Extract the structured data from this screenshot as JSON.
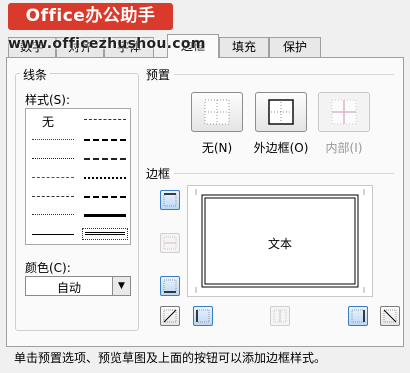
{
  "watermark": {
    "logo_text": "Office办公助手",
    "url_text": "www.officezhushou.com"
  },
  "tabs": [
    {
      "label": "数字",
      "active": false
    },
    {
      "label": "对齐",
      "active": false
    },
    {
      "label": "字体",
      "active": false
    },
    {
      "label": "边框",
      "active": true
    },
    {
      "label": "填充",
      "active": false
    },
    {
      "label": "保护",
      "active": false
    }
  ],
  "line": {
    "group_title": "线条",
    "style_label": "样式(S):",
    "none_label": "无",
    "color_label": "颜色(C):",
    "color_value": "自动"
  },
  "presets": {
    "group_title": "预置",
    "items": [
      {
        "label": "无(N)",
        "icon": "border-none-icon",
        "enabled": true
      },
      {
        "label": "外边框(O)",
        "icon": "border-outline-icon",
        "enabled": true
      },
      {
        "label": "内部(I)",
        "icon": "border-inside-icon",
        "enabled": false
      }
    ]
  },
  "border": {
    "group_title": "边框",
    "preview_text": "文本"
  },
  "footer": {
    "hint": "单击预置选项、预览草图及上面的按钮可以添加边框样式。"
  },
  "colors": {
    "accent": "#3a7bc8",
    "logo_bg": "#d93a2b"
  }
}
